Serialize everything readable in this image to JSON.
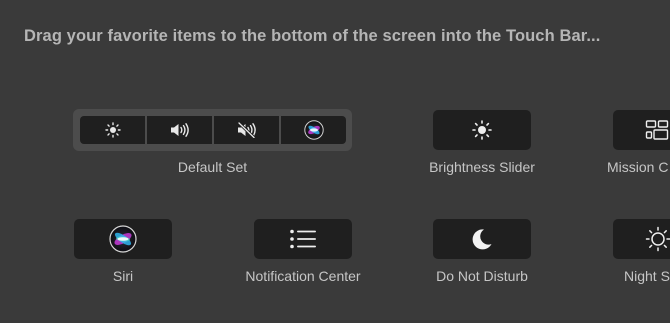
{
  "instruction": "Drag your favorite items to the bottom of the screen into the Touch Bar...",
  "items": [
    {
      "label": "Default Set",
      "icons": [
        "brightness-icon",
        "volume-icon",
        "mute-icon",
        "siri-icon"
      ]
    },
    {
      "label": "Brightness Slider",
      "icon": "brightness-icon"
    },
    {
      "label": "Mission C",
      "icon": "mission-control-icon"
    },
    {
      "label": "Siri",
      "icon": "siri-icon"
    },
    {
      "label": "Notification Center",
      "icon": "list-icon"
    },
    {
      "label": "Do Not Disturb",
      "icon": "moon-icon"
    },
    {
      "label": "Night S",
      "icon": "night-shift-icon"
    }
  ],
  "colors": {
    "background": "#3a3a3a",
    "button": "#1f1f1f",
    "group_frame": "#4c4c4c",
    "label": "#c6c6c6",
    "instruction": "#b5b5b5"
  }
}
